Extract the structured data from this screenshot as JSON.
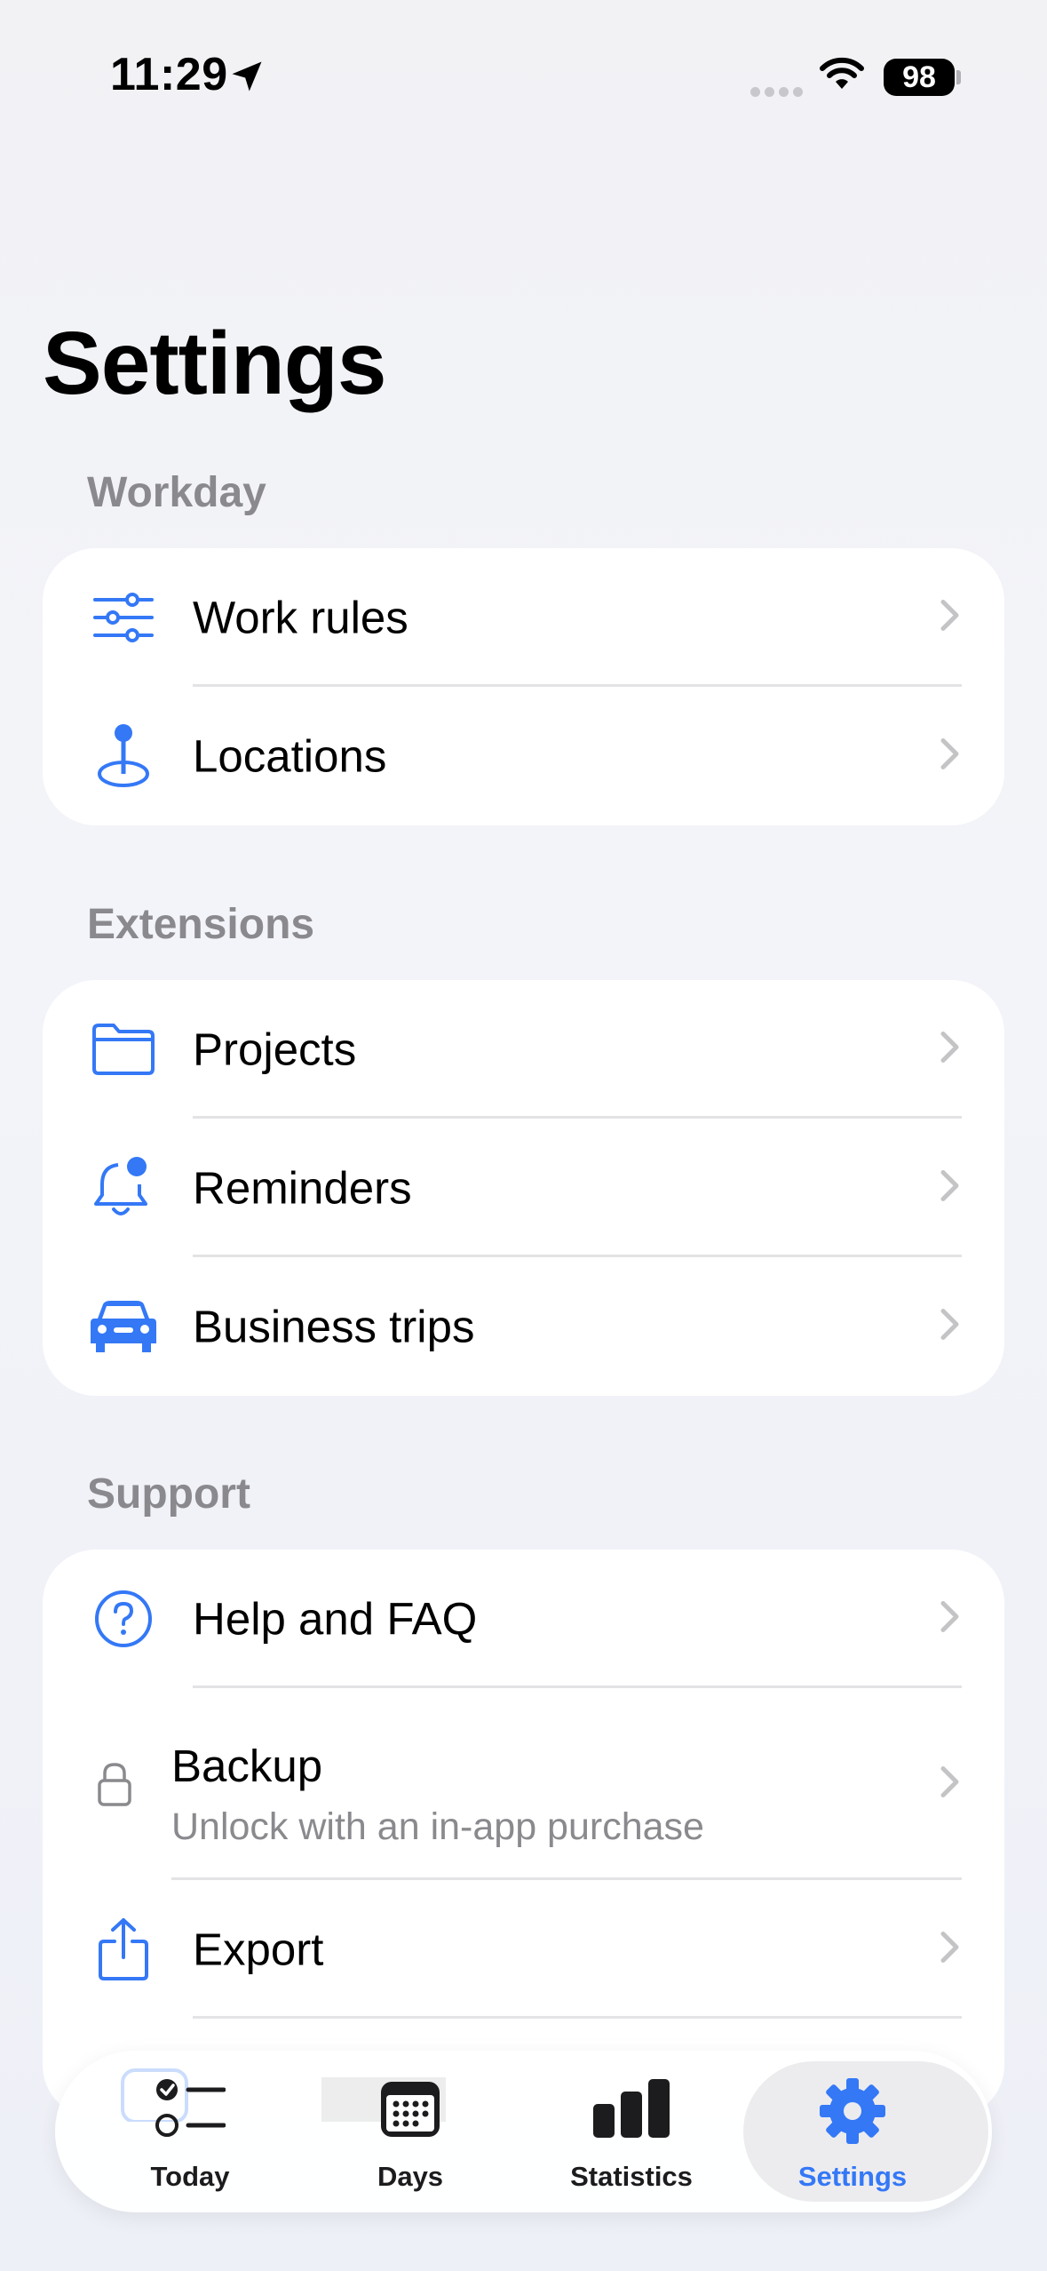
{
  "status_bar": {
    "time": "11:29",
    "battery": "98"
  },
  "page": {
    "title": "Settings"
  },
  "sections": {
    "workday": {
      "header": "Workday",
      "items": [
        {
          "label": "Work rules",
          "icon": "sliders-icon"
        },
        {
          "label": "Locations",
          "icon": "location-pin-icon"
        }
      ]
    },
    "extensions": {
      "header": "Extensions",
      "items": [
        {
          "label": "Projects",
          "icon": "folder-icon"
        },
        {
          "label": "Reminders",
          "icon": "bell-badge-icon"
        },
        {
          "label": "Business trips",
          "icon": "car-icon"
        }
      ]
    },
    "support": {
      "header": "Support",
      "items": [
        {
          "label": "Help and FAQ",
          "icon": "question-circle-icon"
        },
        {
          "label": "Backup",
          "sublabel": "Unlock with an in-app purchase",
          "icon": "lock-icon"
        },
        {
          "label": "Export",
          "icon": "share-icon"
        }
      ]
    }
  },
  "tab_bar": {
    "tabs": [
      {
        "label": "Today",
        "icon": "checklist-icon"
      },
      {
        "label": "Days",
        "icon": "calendar-icon"
      },
      {
        "label": "Statistics",
        "icon": "bar-chart-icon"
      },
      {
        "label": "Settings",
        "icon": "gear-icon",
        "selected": true
      }
    ]
  },
  "colors": {
    "accent": "#3478f6",
    "secondary_text": "#8a8a8e",
    "card": "#ffffff",
    "divider": "#e3e3e6"
  }
}
